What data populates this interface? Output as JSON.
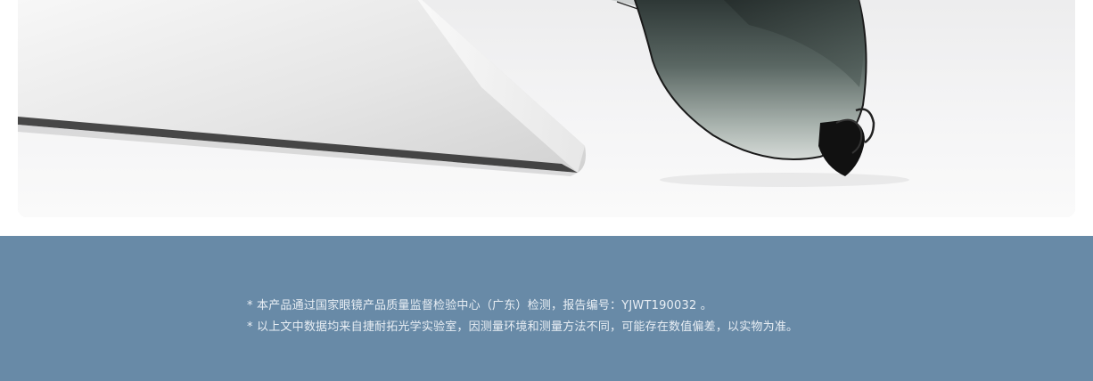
{
  "product_image": {
    "icon": "sunglasses-photo"
  },
  "disclaimer": {
    "lines": [
      "* 本产品通过国家眼镜产品质量监督检验中心（广东）检测，报告编号：YJWT190032 。",
      "* 以上文中数据均来自捷耐拓光学实验室，因测量环境和测量方法不同，可能存在数值偏差，以实物为准。"
    ]
  },
  "colors": {
    "footer_background": "#688aa7",
    "footer_text": "#e8eef4",
    "card_background": "#f4f4f5"
  }
}
